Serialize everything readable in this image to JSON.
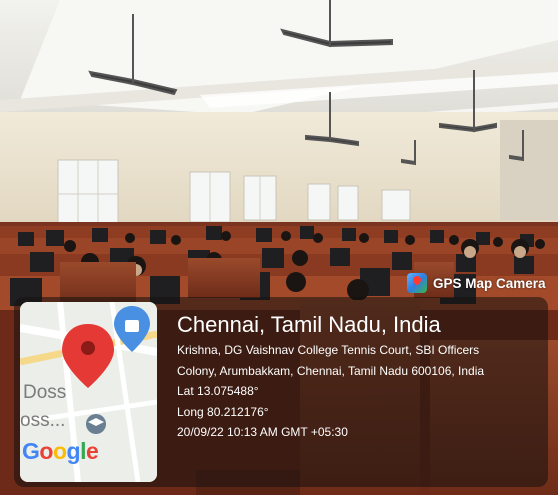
{
  "badge": {
    "app_name": "GPS Map Camera",
    "icon": "gps-map-camera-app-icon"
  },
  "map": {
    "labels": [
      "Doss",
      "oss..."
    ],
    "logo_text": "Google",
    "pin_color": "#e53935",
    "place_icon": "shopping-bag-icon",
    "poi_icon": "graduation-cap-icon"
  },
  "location": {
    "title": "Chennai, Tamil Nadu, India",
    "address_line1": "Krishna, DG Vaishnav College Tennis Court, SBI Officers",
    "address_line2": "Colony, Arumbakkam, Chennai, Tamil Nadu 600106, India",
    "lat": "Lat 13.075488°",
    "long": "Long 80.212176°",
    "timestamp": "20/09/22 10:13 AM GMT +05:30"
  },
  "colors": {
    "overlay": "#14100e",
    "cubicle_wood": "#8a3a22",
    "wall": "#efe8d8"
  }
}
